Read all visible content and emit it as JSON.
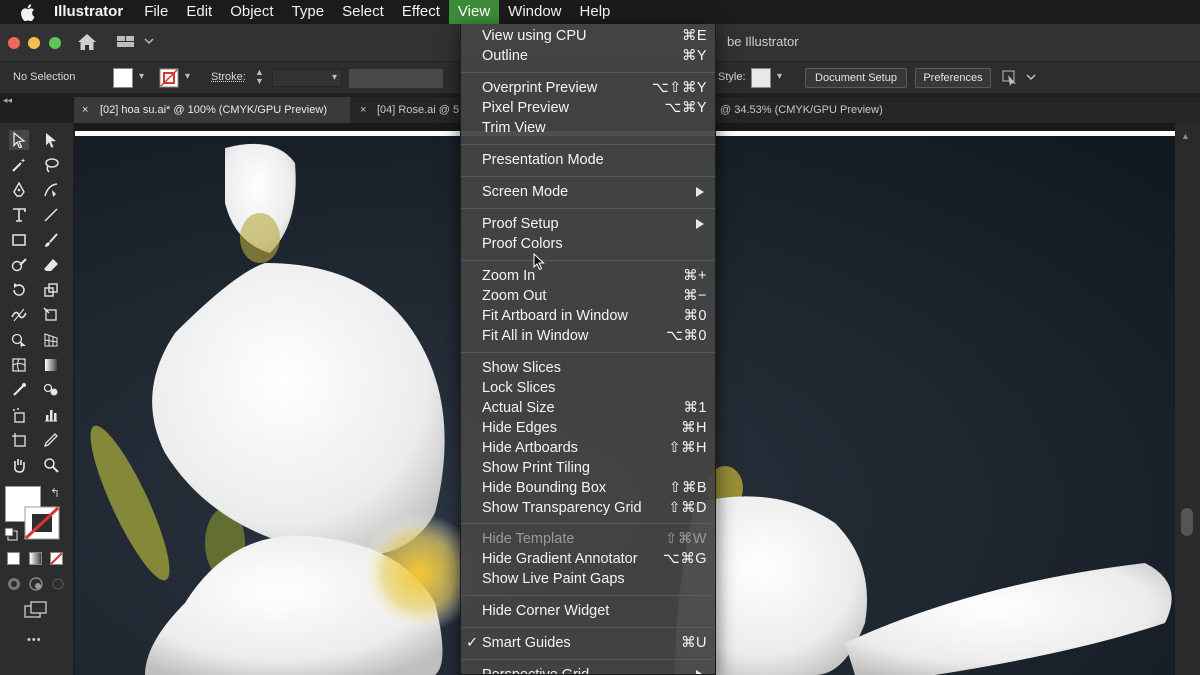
{
  "menubar": {
    "app_name": "Illustrator",
    "menus": [
      "File",
      "Edit",
      "Object",
      "Type",
      "Select",
      "Effect",
      "View",
      "Window",
      "Help"
    ],
    "active_menu": "View"
  },
  "appbar": {
    "title": "be Illustrator"
  },
  "controlbar": {
    "selection": "No Selection",
    "stroke_label": "Stroke:",
    "style_label": "Style:",
    "document_setup": "Document Setup",
    "preferences": "Preferences"
  },
  "tabs": [
    {
      "close": "×",
      "label": "[02] hoa su.ai* @ 100% (CMYK/GPU Preview)"
    },
    {
      "close": "×",
      "label": "[04] Rose.ai @ 5"
    },
    {
      "close": "",
      "label": "@ 34.53% (CMYK/GPU Preview)"
    }
  ],
  "view_menu": {
    "items": [
      {
        "label": "View using CPU",
        "shortcut": "⌘E"
      },
      {
        "label": "Outline",
        "shortcut": "⌘Y"
      },
      {
        "label": "Overprint Preview",
        "shortcut": "⌥⇧⌘Y"
      },
      {
        "label": "Pixel Preview",
        "shortcut": "⌥⌘Y"
      },
      {
        "label": "Trim View",
        "shortcut": ""
      },
      {
        "label": "Presentation Mode",
        "shortcut": ""
      },
      {
        "label": "Screen Mode",
        "shortcut": "",
        "submenu": true
      },
      {
        "label": "Proof Setup",
        "shortcut": "",
        "submenu": true
      },
      {
        "label": "Proof Colors",
        "shortcut": ""
      },
      {
        "label": "Zoom In",
        "shortcut": "⌘+"
      },
      {
        "label": "Zoom Out",
        "shortcut": "⌘−"
      },
      {
        "label": "Fit Artboard in Window",
        "shortcut": "⌘0"
      },
      {
        "label": "Fit All in Window",
        "shortcut": "⌥⌘0"
      },
      {
        "label": "Show Slices",
        "shortcut": ""
      },
      {
        "label": "Lock Slices",
        "shortcut": ""
      },
      {
        "label": "Actual Size",
        "shortcut": "⌘1"
      },
      {
        "label": "Hide Edges",
        "shortcut": "⌘H"
      },
      {
        "label": "Hide Artboards",
        "shortcut": "⇧⌘H"
      },
      {
        "label": "Show Print Tiling",
        "shortcut": ""
      },
      {
        "label": "Hide Bounding Box",
        "shortcut": "⇧⌘B"
      },
      {
        "label": "Show Transparency Grid",
        "shortcut": "⇧⌘D"
      },
      {
        "label": "Hide Template",
        "shortcut": "⇧⌘W",
        "disabled": true
      },
      {
        "label": "Hide Gradient Annotator",
        "shortcut": "⌥⌘G"
      },
      {
        "label": "Show Live Paint Gaps",
        "shortcut": ""
      },
      {
        "label": "Hide Corner Widget",
        "shortcut": ""
      },
      {
        "label": "Smart Guides",
        "shortcut": "⌘U",
        "checked": true
      },
      {
        "label": "Perspective Grid",
        "shortcut": "",
        "submenu": true
      }
    ],
    "check_mark": "✓"
  },
  "tools_more": "•••",
  "colors": {
    "menu_active": "#3d8b38",
    "menu_bg": "#444444",
    "canvas_bg": "#1d232a"
  }
}
